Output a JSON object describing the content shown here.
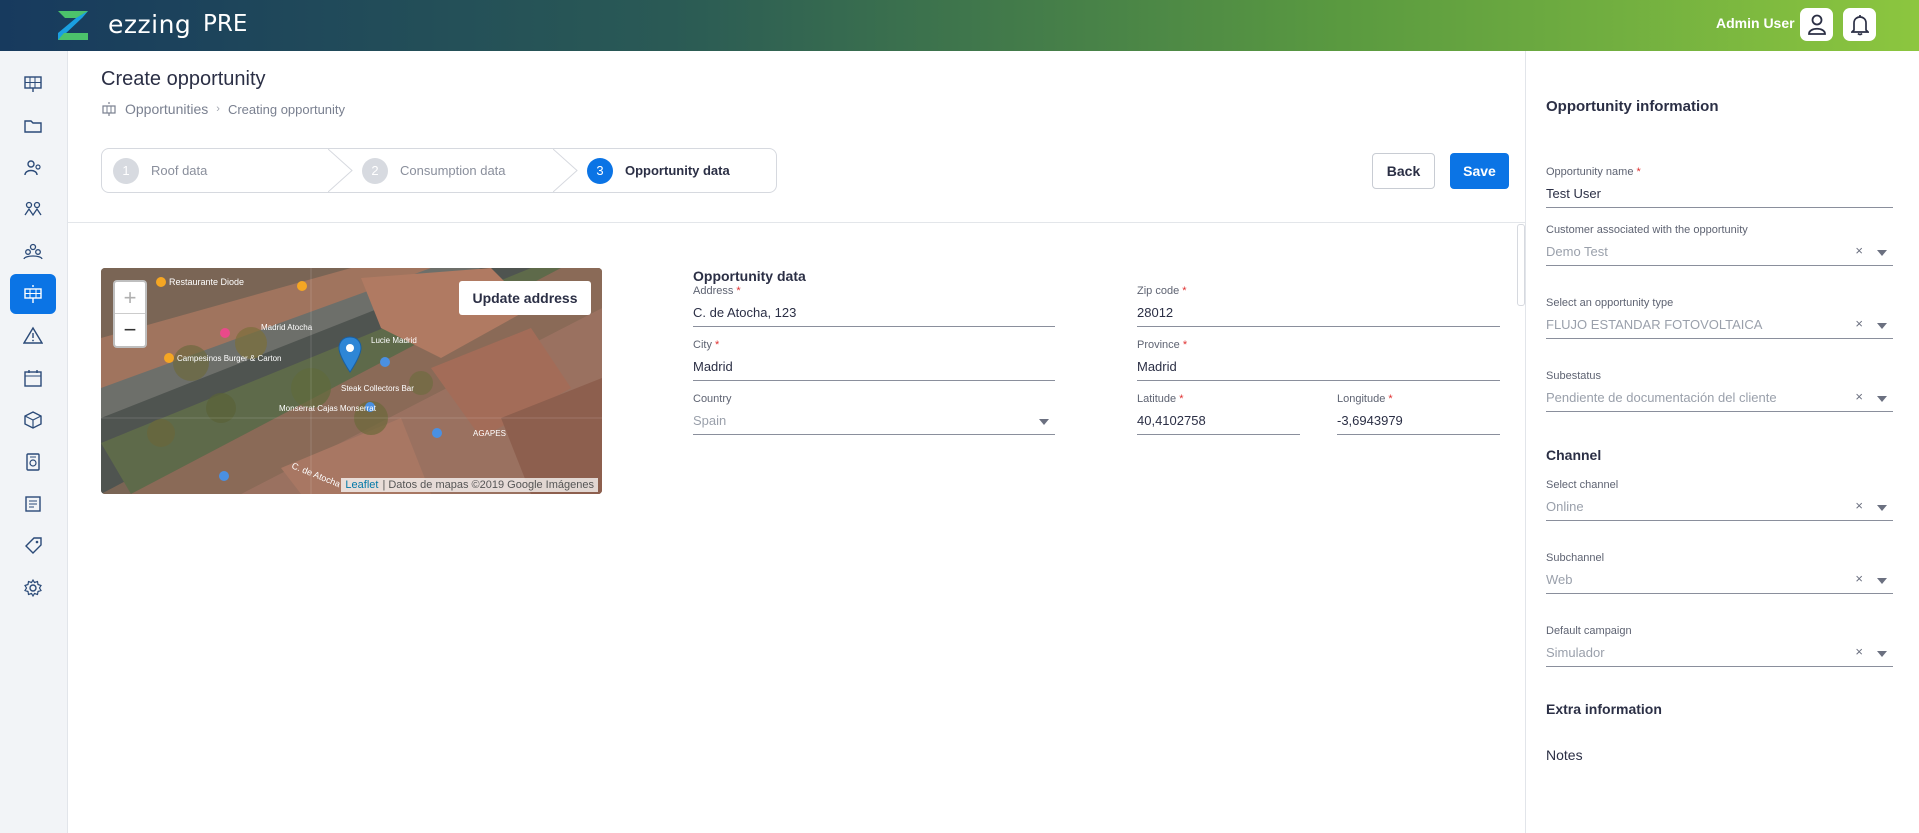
{
  "header": {
    "brand": "ezzing",
    "environment": "PRE",
    "user_name": "Admin User",
    "colors": {
      "gradient_start": "#173a5e",
      "gradient_end": "#8cc63f",
      "logo_green": "#4cc26b",
      "logo_blue": "#1a9fe0"
    }
  },
  "sidebar": {
    "items": [
      {
        "icon": "solar-panel-screen-icon"
      },
      {
        "icon": "folder-icon"
      },
      {
        "icon": "users-icon"
      },
      {
        "icon": "leads-icon"
      },
      {
        "icon": "group-icon"
      },
      {
        "icon": "solar-opportunity-icon",
        "active": true
      },
      {
        "icon": "warning-icon"
      },
      {
        "icon": "calendar-icon"
      },
      {
        "icon": "box-icon"
      },
      {
        "icon": "invoice-icon"
      },
      {
        "icon": "report-icon"
      },
      {
        "icon": "tag-icon"
      },
      {
        "icon": "settings-icon"
      }
    ],
    "active_color": "#0b74e5"
  },
  "page": {
    "title": "Create opportunity",
    "breadcrumb": {
      "first": "Opportunities",
      "second": "Creating opportunity"
    }
  },
  "stepper": {
    "steps": [
      {
        "number": "1",
        "label": "Roof data"
      },
      {
        "number": "2",
        "label": "Consumption data"
      },
      {
        "number": "3",
        "label": "Opportunity data",
        "active": true
      }
    ]
  },
  "actions": {
    "back": "Back",
    "save": "Save"
  },
  "map": {
    "update_button": "Update address",
    "zoom_in": "+",
    "zoom_out": "−",
    "attribution_link": "Leaflet",
    "attribution_text": "| Datos de mapas ©2019 Google Imágenes",
    "labels": {
      "l1": "Restaurante Diode",
      "l2": "Campesinos Burger & Carton",
      "l3": "Lucie Madrid",
      "l4": "Steak Collectors Bar",
      "l5": "Monserrat Cajas Monserrat",
      "l6": "AGAPES",
      "l7": "Madrid Atocha",
      "l8": "C. de Atocha"
    }
  },
  "form": {
    "section_title": "Opportunity data",
    "address": {
      "label": "Address",
      "value": "C. de Atocha, 123"
    },
    "zip": {
      "label": "Zip code",
      "value": "28012"
    },
    "city": {
      "label": "City",
      "value": "Madrid"
    },
    "province": {
      "label": "Province",
      "value": "Madrid"
    },
    "country": {
      "label": "Country",
      "value": "Spain"
    },
    "latitude": {
      "label": "Latitude",
      "value": "40,4102758"
    },
    "longitude": {
      "label": "Longitude",
      "value": "-3,6943979"
    },
    "required_mark": "*"
  },
  "panel": {
    "title": "Opportunity information",
    "opportunity_name": {
      "label": "Opportunity name",
      "value": "Test User"
    },
    "customer": {
      "label": "Customer associated with the opportunity",
      "value": "Demo Test"
    },
    "type": {
      "label": "Select an opportunity type",
      "value": "FLUJO ESTANDAR FOTOVOLTAICA"
    },
    "substatus": {
      "label": "Subestatus",
      "value": "Pendiente de documentación del cliente"
    },
    "channel_title": "Channel",
    "channel": {
      "label": "Select channel",
      "value": "Online"
    },
    "subchannel": {
      "label": "Subchannel",
      "value": "Web"
    },
    "campaign": {
      "label": "Default campaign",
      "value": "Simulador"
    },
    "extra_title": "Extra information",
    "notes_label": "Notes",
    "clear_symbol": "×"
  }
}
